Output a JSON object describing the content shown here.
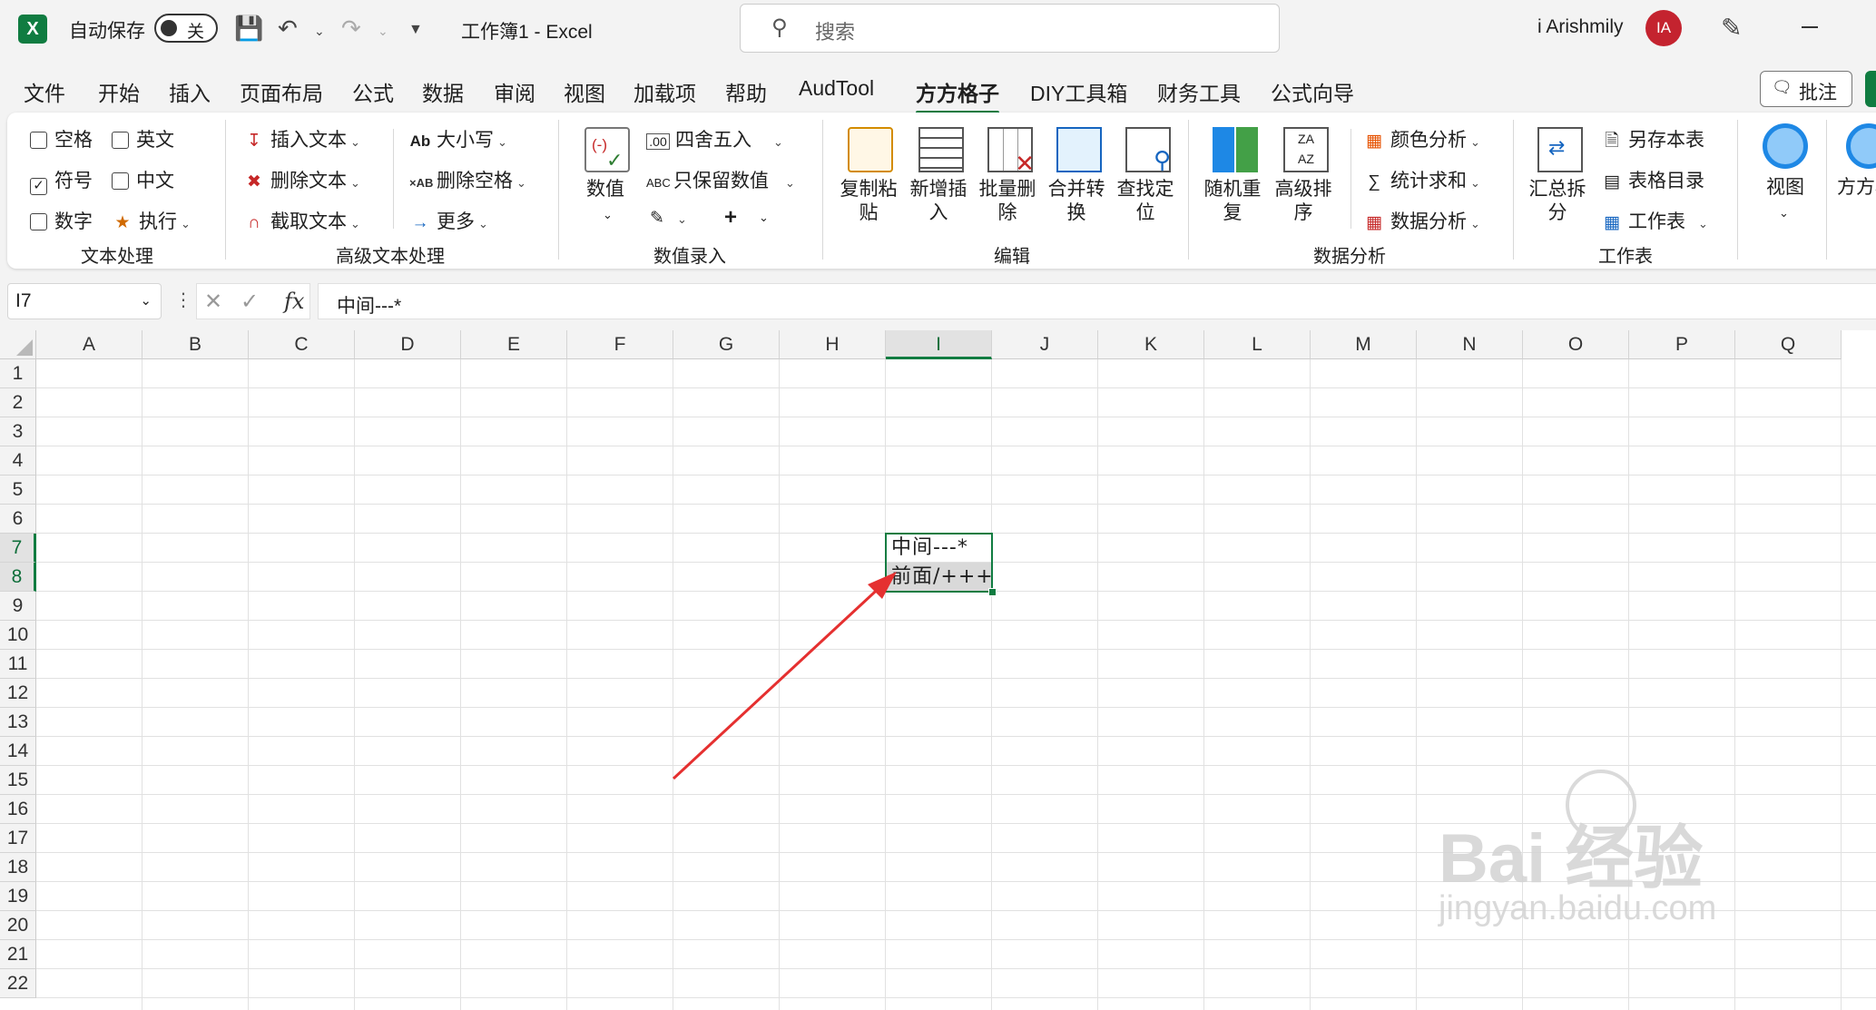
{
  "titlebar": {
    "autosave_label": "自动保存",
    "autosave_state": "关",
    "doc_title": "工作簿1  -  Excel",
    "search_placeholder": "搜索",
    "user_name": "i Arishmily",
    "avatar_initials": "IA"
  },
  "menu": {
    "items": [
      "文件",
      "开始",
      "插入",
      "页面布局",
      "公式",
      "数据",
      "审阅",
      "视图",
      "加载项",
      "帮助",
      "AudTool",
      "方方格子",
      "DIY工具箱",
      "财务工具",
      "公式向导"
    ],
    "active": "方方格子",
    "comment_label": "批注"
  },
  "ribbon": {
    "text_group": {
      "checkboxes": [
        {
          "label": "空格",
          "checked": false
        },
        {
          "label": "英文",
          "checked": false
        },
        {
          "label": "符号",
          "checked": true
        },
        {
          "label": "中文",
          "checked": false
        },
        {
          "label": "数字",
          "checked": false
        }
      ],
      "execute_label": "执行",
      "group_label": "文本处理"
    },
    "advanced_text": {
      "insert_text": "插入文本",
      "delete_text": "删除文本",
      "extract_text": "截取文本",
      "case_label": "大小写",
      "delete_space": "删除空格",
      "more_label": "更多",
      "group_label": "高级文本处理"
    },
    "numeric": {
      "numeric_label": "数值",
      "round_label": "四舍五入",
      "keep_value_label": "只保留数值",
      "group_label": "数值录入"
    },
    "edit": {
      "copy_paste": "复制粘贴",
      "add_insert": "新增插入",
      "batch_delete": "批量删除",
      "merge_convert": "合并转换",
      "find_locate": "查找定位",
      "group_label": "编辑"
    },
    "data_analysis": {
      "random_repeat": "随机重复",
      "advanced_sort": "高级排序",
      "color_analysis": "颜色分析",
      "stat_sum": "统计求和",
      "data_analysis": "数据分析",
      "group_label": "数据分析"
    },
    "worksheet": {
      "summary_split": "汇总拆分",
      "save_sheet": "另存本表",
      "sheet_toc": "表格目录",
      "worksheet_label": "工作表",
      "group_label": "工作表"
    },
    "view_label": "视图",
    "fangfang_label": "方方格子"
  },
  "formula_bar": {
    "name_box": "I7",
    "fx": "fx",
    "content": "中间---*"
  },
  "sheet": {
    "columns": [
      "A",
      "B",
      "C",
      "D",
      "E",
      "F",
      "G",
      "H",
      "I",
      "J",
      "K",
      "L",
      "M",
      "N",
      "O",
      "P",
      "Q"
    ],
    "selected_column": "I",
    "rows": [
      "1",
      "2",
      "3",
      "4",
      "5",
      "6",
      "7",
      "8",
      "9",
      "10",
      "11",
      "12",
      "13",
      "14",
      "15",
      "16",
      "17",
      "18",
      "19",
      "20",
      "21",
      "22"
    ],
    "selected_rows": [
      "7",
      "8"
    ],
    "cells": {
      "I7": "中间---*",
      "I8": "前面/+++"
    }
  },
  "annotation": {
    "arrow_color": "#e53030"
  },
  "watermark": {
    "brand": "Bai 经验",
    "url": "jingyan.baidu.com"
  }
}
